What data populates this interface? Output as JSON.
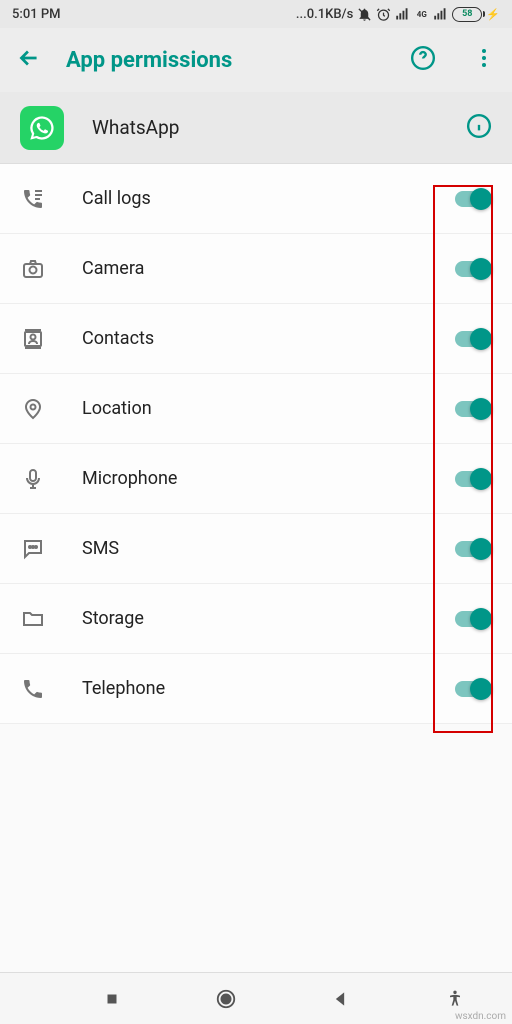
{
  "status": {
    "time": "5:01 PM",
    "net_speed": "0.1KB/s",
    "battery_pct": "58"
  },
  "header": {
    "title": "App permissions"
  },
  "app": {
    "name": "WhatsApp"
  },
  "permissions": [
    {
      "key": "call-logs",
      "label": "Call logs",
      "icon": "phone-log",
      "enabled": true
    },
    {
      "key": "camera",
      "label": "Camera",
      "icon": "camera",
      "enabled": true
    },
    {
      "key": "contacts",
      "label": "Contacts",
      "icon": "contacts",
      "enabled": true
    },
    {
      "key": "location",
      "label": "Location",
      "icon": "pin",
      "enabled": true
    },
    {
      "key": "microphone",
      "label": "Microphone",
      "icon": "mic",
      "enabled": true
    },
    {
      "key": "sms",
      "label": "SMS",
      "icon": "sms",
      "enabled": true
    },
    {
      "key": "storage",
      "label": "Storage",
      "icon": "folder",
      "enabled": true
    },
    {
      "key": "telephone",
      "label": "Telephone",
      "icon": "phone",
      "enabled": true
    }
  ],
  "watermark": "wsxdn.com",
  "colors": {
    "accent": "#009688",
    "highlight": "#d40000",
    "whatsapp": "#25D366"
  }
}
